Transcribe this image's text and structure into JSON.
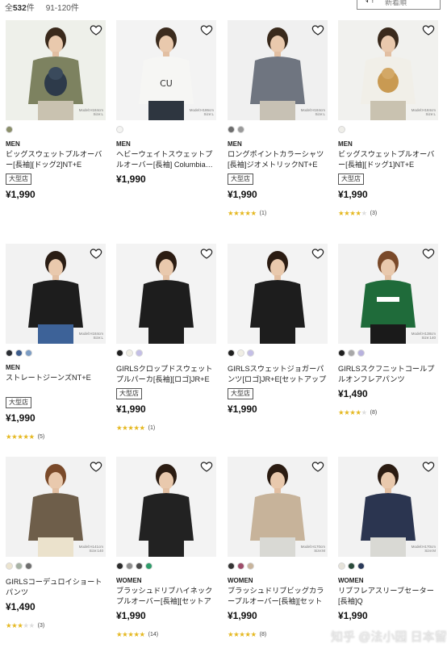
{
  "colors": {
    "star": "#e5b820",
    "text": "#1b1b1b"
  },
  "header": {
    "total_prefix": "全",
    "total_count": "532",
    "total_suffix": "件",
    "range": "91-120件",
    "sort_icon": "sort-icon",
    "sort_label": "新着順"
  },
  "products": [
    {
      "gender": "MEN",
      "name": "ビッグスウェットプルオーバー[長袖][ドッグ2]NT+E",
      "badge": "大型店",
      "price": "¥1,990",
      "swatches": [
        "#8b8f6a"
      ],
      "rating": null,
      "reviews": "",
      "model_note": "Model:H184cm\nSize:L",
      "bg": "#eef0ea",
      "shirt": "#7d8260",
      "pants": "#c9c2b0",
      "hair": "#3a2a1c"
    },
    {
      "gender": "MEN",
      "name": "ヘビーウェイトスウェットプルオーバー[長袖] Columbia…",
      "badge": "",
      "price": "¥1,990",
      "swatches": [
        "#f4f4f2"
      ],
      "rating": null,
      "reviews": "",
      "model_note": "Model:H186cm\nSize:L",
      "bg": "#f3f3f3",
      "shirt": "#f6f6f4",
      "pants": "#2e3640",
      "hair": "#3b2b1e"
    },
    {
      "gender": "MEN",
      "name": "ロングポイントカラーシャツ[長袖]ジオメトリックNT+E",
      "badge": "大型店",
      "price": "¥1,990",
      "swatches": [
        "#6c6c6c",
        "#9a9a9a"
      ],
      "rating": 5,
      "reviews": "(1)",
      "model_note": "Model:H184cm\nSize:L",
      "bg": "#f0f0f0",
      "shirt": "#6f7580",
      "pants": "#c7c1b4",
      "hair": "#3a2a1c"
    },
    {
      "gender": "MEN",
      "name": "ビッグスウェットプルオーバー[長袖][ドッグ1]NT+E",
      "badge": "大型店",
      "price": "¥1,990",
      "swatches": [
        "#efeee9"
      ],
      "rating": 4,
      "reviews": "(3)",
      "model_note": "Model:H184cm\nSize:L",
      "bg": "#f1f1ee",
      "shirt": "#f1efe8",
      "pants": "#c9c2b0",
      "hair": "#3a2a1c"
    },
    {
      "gender": "MEN",
      "name": "ストレートジーンズNT+E",
      "badge": "大型店",
      "price": "¥1,990",
      "swatches": [
        "#2a2d33",
        "#3c5c8c",
        "#7c9dc4"
      ],
      "rating": 5,
      "reviews": "(5)",
      "model_note": "Model:H184cm\nSize:L",
      "bg": "#f2f2f2",
      "shirt": "#1d1d1d",
      "pants": "#3d6298",
      "hair": "#2a1d14"
    },
    {
      "gender": "",
      "name": "GIRLSクロップドスウェットプルパーカ[長袖][ロゴ]JR+E[セ…",
      "badge": "大型店",
      "price": "¥1,990",
      "swatches": [
        "#1f1f1f",
        "#f0eee4",
        "#c4bfe6"
      ],
      "rating": 5,
      "reviews": "(1)",
      "model_note": "",
      "bg": "#f3f3f3",
      "shirt": "#1d1d1d",
      "pants": "#1d1d1d",
      "hair": "#2b1c12"
    },
    {
      "gender": "",
      "name": "GIRLSスウェットジョガーパンツ[ロゴ]JR+E[セットアップ可能]",
      "badge": "大型店",
      "price": "¥1,990",
      "swatches": [
        "#1f1f1f",
        "#f0eee4",
        "#c4bfe6"
      ],
      "rating": null,
      "reviews": "",
      "model_note": "",
      "bg": "#f3f3f3",
      "shirt": "#1d1d1d",
      "pants": "#1d1d1d",
      "hair": "#2b1c12"
    },
    {
      "gender": "",
      "name": "GIRLSスクフニットコールプルオンフレアパンツ",
      "badge": "",
      "price": "¥1,490",
      "swatches": [
        "#1f1f1f",
        "#a8a8a8",
        "#b8b2de"
      ],
      "rating": 4,
      "reviews": "(8)",
      "model_note": "Model:H138cm\nSize:140",
      "bg": "#f2f2f2",
      "shirt": "#1f6b3a",
      "pants": "#1a1a1a",
      "hair": "#7a4a2a"
    },
    {
      "gender": "",
      "name": "GIRLSコーデュロイショートパンツ",
      "badge": "",
      "price": "¥1,490",
      "swatches": [
        "#ece4cf",
        "#a7b3a5",
        "#6e6e6e"
      ],
      "rating": 3,
      "reviews": "(3)",
      "model_note": "Model:H141cm\nSize:140",
      "bg": "#f2f2f2",
      "shirt": "#6e5e4a",
      "pants": "#ebe2cc",
      "hair": "#7a4a2a"
    },
    {
      "gender": "WOMEN",
      "name": "ブラッシュドリブハイネックプルオーバー[長袖][セットアップ…",
      "badge": "",
      "price": "¥1,990",
      "swatches": [
        "#2b2b2b",
        "#8d8d8d",
        "#4a4a4a",
        "#2f9c6a"
      ],
      "rating": 5,
      "reviews": "(14)",
      "model_note": "",
      "bg": "#f3f3f3",
      "shirt": "#222222",
      "pants": "#222222",
      "hair": "#2b1c12"
    },
    {
      "gender": "WOMEN",
      "name": "ブラッシュドリブビッグカラープルオーバー[長袖][セットアップ…",
      "badge": "",
      "price": "¥1,990",
      "swatches": [
        "#333333",
        "#9e4c6a",
        "#c8b49c"
      ],
      "rating": 5,
      "reviews": "(8)",
      "model_note": "Model:H170cm\nSize:M",
      "bg": "#f2f2f2",
      "shirt": "#c7b39a",
      "pants": "#d9d9d4",
      "hair": "#2b1c12"
    },
    {
      "gender": "WOMEN",
      "name": "リブフレアスリーブセーター[長袖]Q",
      "badge": "",
      "price": "¥1,990",
      "swatches": [
        "#e6e3da",
        "#2a4a3a",
        "#2b3a5a"
      ],
      "rating": null,
      "reviews": "",
      "model_note": "Model:H170cm\nSize:M",
      "bg": "#f2f2f2",
      "shirt": "#2b3550",
      "pants": "#d9d9d4",
      "hair": "#2b1c12"
    }
  ],
  "watermark": "知乎 @法小园 日本留学"
}
